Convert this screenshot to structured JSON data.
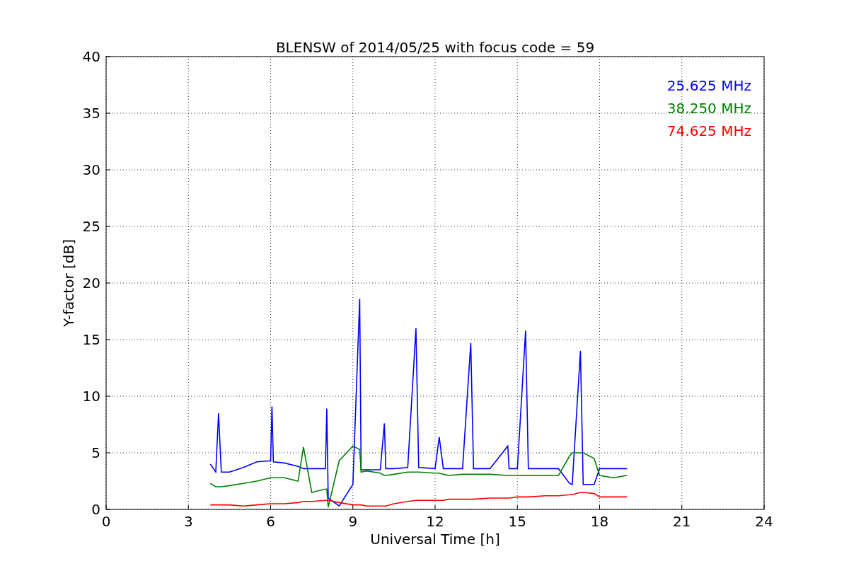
{
  "chart_data": {
    "type": "line",
    "title": "BLENSW of 2014/05/25 with focus code = 59",
    "xlabel": "Universal Time [h]",
    "ylabel": "Y-factor [dB]",
    "x": [
      3.8,
      4.0,
      4.1,
      4.2,
      4.5,
      5.0,
      5.5,
      6.0,
      6.05,
      6.1,
      6.5,
      7.0,
      7.2,
      7.5,
      8.0,
      8.05,
      8.1,
      8.5,
      9.0,
      9.25,
      9.3,
      9.5,
      10.0,
      10.15,
      10.2,
      10.5,
      11.0,
      11.3,
      11.4,
      12.0,
      12.15,
      12.3,
      12.5,
      13.0,
      13.3,
      13.4,
      14.0,
      14.65,
      14.7,
      15.0,
      15.3,
      15.4,
      16.0,
      16.5,
      16.9,
      17.0,
      17.3,
      17.4,
      17.8,
      18.0,
      18.5,
      19.0
    ],
    "series": [
      {
        "name": "25.625 MHz",
        "color": "#0000ff",
        "values": [
          4.0,
          3.3,
          8.5,
          3.3,
          3.3,
          3.7,
          4.2,
          4.3,
          9.1,
          4.2,
          4.1,
          3.8,
          3.6,
          3.6,
          3.6,
          8.9,
          1.0,
          0.3,
          2.2,
          18.6,
          3.5,
          3.5,
          3.5,
          7.6,
          3.6,
          3.6,
          3.7,
          16.0,
          3.7,
          3.6,
          6.4,
          3.6,
          3.6,
          3.6,
          14.7,
          3.6,
          3.6,
          5.6,
          3.6,
          3.6,
          15.8,
          3.6,
          3.6,
          3.6,
          2.3,
          2.2,
          14.0,
          2.2,
          2.2,
          3.6,
          3.6,
          3.6
        ]
      },
      {
        "name": "38.250 MHz",
        "color": "#008000",
        "values": [
          2.3,
          2.0,
          2.0,
          2.0,
          2.1,
          2.3,
          2.5,
          2.8,
          2.8,
          2.8,
          2.8,
          2.5,
          5.5,
          1.5,
          1.8,
          1.8,
          0.2,
          4.3,
          5.6,
          5.3,
          3.3,
          3.4,
          3.2,
          3.0,
          3.0,
          3.1,
          3.3,
          3.3,
          3.3,
          3.2,
          3.2,
          3.1,
          3.0,
          3.1,
          3.1,
          3.1,
          3.1,
          3.0,
          3.0,
          3.0,
          3.0,
          3.0,
          3.0,
          3.0,
          4.7,
          5.0,
          5.0,
          5.0,
          4.5,
          3.0,
          2.8,
          3.0
        ]
      },
      {
        "name": "74.625 MHz",
        "color": "#ff0000",
        "values": [
          0.4,
          0.4,
          0.4,
          0.4,
          0.4,
          0.3,
          0.4,
          0.5,
          0.5,
          0.5,
          0.5,
          0.6,
          0.7,
          0.7,
          0.8,
          0.8,
          0.8,
          0.6,
          0.4,
          0.4,
          0.4,
          0.3,
          0.3,
          0.3,
          0.3,
          0.5,
          0.7,
          0.8,
          0.8,
          0.8,
          0.8,
          0.8,
          0.9,
          0.9,
          0.9,
          0.9,
          1.0,
          1.0,
          1.0,
          1.1,
          1.1,
          1.1,
          1.2,
          1.2,
          1.3,
          1.3,
          1.5,
          1.5,
          1.4,
          1.1,
          1.1,
          1.1
        ]
      }
    ],
    "xlim": [
      0,
      24
    ],
    "ylim": [
      0,
      40
    ],
    "xticks": [
      0,
      3,
      6,
      9,
      12,
      15,
      18,
      21,
      24
    ],
    "yticks": [
      0,
      5,
      10,
      15,
      20,
      25,
      30,
      35,
      40
    ],
    "grid": true
  }
}
